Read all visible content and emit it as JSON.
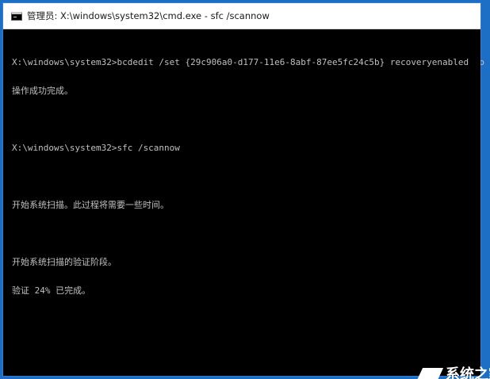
{
  "window": {
    "title": "管理员: X:\\windows\\system32\\cmd.exe - sfc  /scannow"
  },
  "console": {
    "lines": [
      "X:\\windows\\system32>bcdedit /set {29c906a0-d177-11e6-8abf-87ee5fc24c5b} recoveryenabled No",
      "操作成功完成。",
      "",
      "X:\\windows\\system32>sfc /scannow",
      "",
      "开始系统扫描。此过程将需要一些时间。",
      "",
      "开始系统扫描的验证阶段。",
      "验证 24% 已完成。"
    ]
  },
  "verification_progress_percent": 24,
  "watermark": {
    "text": "系统之家"
  },
  "colors": {
    "console_bg": "#000000",
    "console_text": "#c0c0c0",
    "titlebar_bg": "#ffffff",
    "desktop_bg": "#1c6fc4"
  }
}
